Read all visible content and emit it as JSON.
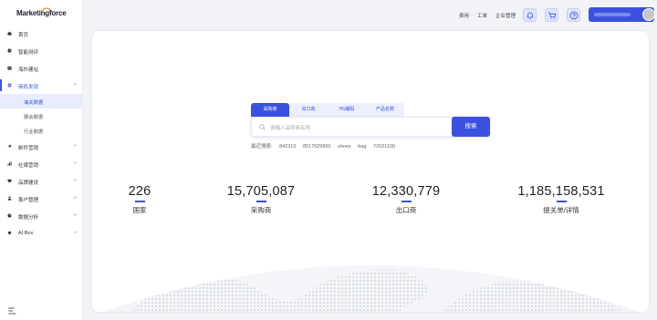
{
  "brand": {
    "logo_text": "Marketingforce"
  },
  "sidebar": {
    "items": [
      {
        "label": "首页",
        "icon": "home-icon",
        "has_chevron": false
      },
      {
        "label": "智能测评",
        "icon": "gauge-icon",
        "has_chevron": false
      },
      {
        "label": "海外建站",
        "icon": "site-icon",
        "has_chevron": false
      },
      {
        "label": "商机发现",
        "icon": "chip-icon",
        "has_chevron": true,
        "active": true
      },
      {
        "label": "邮件营销",
        "icon": "send-icon",
        "has_chevron": true
      },
      {
        "label": "社媒营销",
        "icon": "bar-chart-icon",
        "has_chevron": true
      },
      {
        "label": "品牌建设",
        "icon": "heart-icon",
        "has_chevron": true
      },
      {
        "label": "客户管理",
        "icon": "user-icon",
        "has_chevron": true
      },
      {
        "label": "数据分析",
        "icon": "pie-icon",
        "has_chevron": true
      },
      {
        "label": "AI Box",
        "icon": "ai-icon",
        "has_chevron": true
      }
    ],
    "sub_items": [
      {
        "label": "海关数据",
        "selected": true
      },
      {
        "label": "展会数据",
        "selected": false
      },
      {
        "label": "行业数据",
        "selected": false
      }
    ]
  },
  "header": {
    "links": [
      "费用",
      "工单",
      "企业管理"
    ],
    "icons": [
      "bell-icon",
      "cart-icon",
      "help-icon"
    ]
  },
  "search": {
    "tabs": [
      "采购商",
      "出口商",
      "HS编码",
      "产品名称"
    ],
    "active_tab": 0,
    "placeholder": "请输入采购商名称",
    "button_label": "搜索",
    "recent_label": "最近搜索:",
    "recent_terms": [
      "842310",
      "8517629900",
      "shoes",
      "bag",
      "72021100"
    ]
  },
  "stats": [
    {
      "value": "226",
      "label": "国家"
    },
    {
      "value": "15,705,087",
      "label": "采购商"
    },
    {
      "value": "12,330,779",
      "label": "出口商"
    },
    {
      "value": "1,185,158,531",
      "label": "提关单/详情"
    }
  ],
  "colors": {
    "accent": "#3a51e0",
    "accent_light": "#e8ecfd"
  }
}
